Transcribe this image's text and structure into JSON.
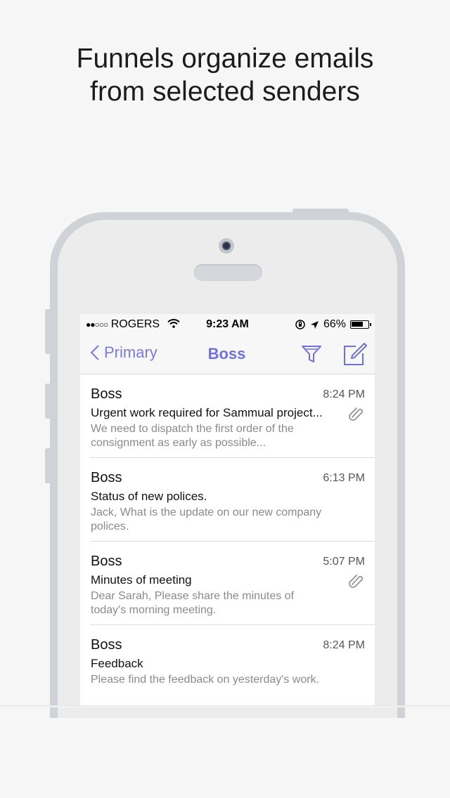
{
  "headline": {
    "line1": "Funnels organize emails",
    "line2": "from selected senders"
  },
  "status_bar": {
    "carrier": "ROGERS",
    "time": "9:23 AM",
    "battery": "66%"
  },
  "nav": {
    "back_label": "Primary",
    "title": "Boss",
    "funnel_icon": "funnel-icon",
    "compose_icon": "compose-icon",
    "accent": "#6f6fe8"
  },
  "emails": [
    {
      "sender": "Boss",
      "time": "8:24 PM",
      "subject": "Urgent work required for Sammual project...",
      "preview": "We need to dispatch the first order of the consignment as early as possible...",
      "attachment": true
    },
    {
      "sender": "Boss",
      "time": "6:13 PM",
      "subject": "Status of new polices.",
      "preview": "Jack, What is the update on our new company polices.",
      "attachment": false
    },
    {
      "sender": "Boss",
      "time": "5:07 PM",
      "subject": "Minutes of meeting",
      "preview": "Dear Sarah, Please share the minutes of today's morning meeting.",
      "attachment": true
    },
    {
      "sender": "Boss",
      "time": "8:24 PM",
      "subject": "Feedback",
      "preview": "Please find the feedback on yesterday's work.",
      "attachment": false
    }
  ]
}
